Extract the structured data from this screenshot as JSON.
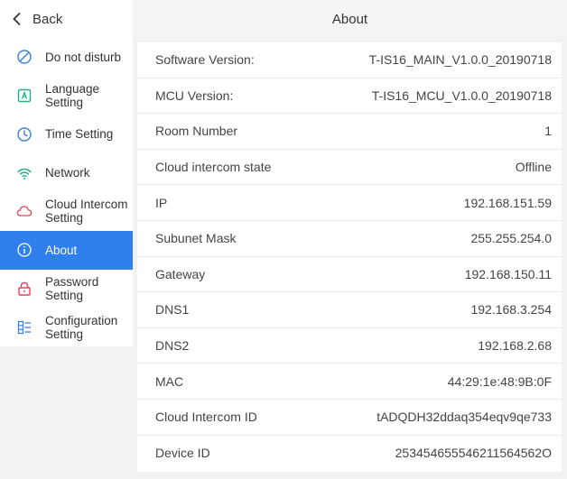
{
  "header": {
    "back_label": "Back",
    "title": "About"
  },
  "sidebar": {
    "items": [
      {
        "label": "Do not disturb",
        "icon": "do-not-disturb-icon",
        "active": false
      },
      {
        "label": "Language\nSetting",
        "icon": "language-icon",
        "active": false
      },
      {
        "label": "Time Setting",
        "icon": "clock-icon",
        "active": false
      },
      {
        "label": "Network",
        "icon": "wifi-icon",
        "active": false
      },
      {
        "label": "Cloud Intercom\nSetting",
        "icon": "cloud-icon",
        "active": false
      },
      {
        "label": "About",
        "icon": "info-icon",
        "active": true
      },
      {
        "label": "Password\nSetting",
        "icon": "lock-icon",
        "active": false
      },
      {
        "label": "Configuration\nSetting",
        "icon": "configuration-icon",
        "active": false
      }
    ]
  },
  "about": {
    "rows": [
      {
        "key": "Software Version:",
        "value": "T-IS16_MAIN_V1.0.0_20190718"
      },
      {
        "key": "MCU Version:",
        "value": "T-IS16_MCU_V1.0.0_20190718"
      },
      {
        "key": "Room Number",
        "value": "1"
      },
      {
        "key": "Cloud intercom state",
        "value": "Offline"
      },
      {
        "key": "IP",
        "value": "192.168.151.59"
      },
      {
        "key": "Subunet Mask",
        "value": "255.255.254.0"
      },
      {
        "key": "Gateway",
        "value": "192.168.150.11"
      },
      {
        "key": "DNS1",
        "value": "192.168.3.254"
      },
      {
        "key": "DNS2",
        "value": "192.168.2.68"
      },
      {
        "key": "MAC",
        "value": "44:29:1e:48:9B:0F"
      },
      {
        "key": "Cloud Intercom ID",
        "value": "tADQDH32ddaq354eqv9qe733"
      },
      {
        "key": "Device ID",
        "value": "253454655546211564562O"
      }
    ]
  },
  "colors": {
    "accent": "#2f80ed",
    "icon_red": "#e0445a",
    "icon_teal": "#23a88a",
    "icon_blue": "#3b82d6"
  }
}
